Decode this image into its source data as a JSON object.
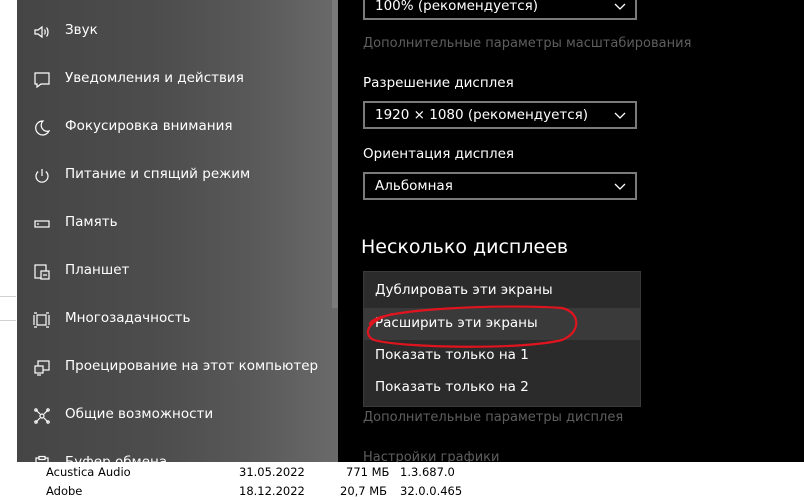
{
  "background_window": {
    "rows": [
      {
        "name": "Acustica Audio",
        "date": "31.05.2022",
        "size": "771 МБ",
        "version": "1.3.687.0"
      },
      {
        "name": "Adobe",
        "date": "18.12.2022",
        "size": "20,7 МБ",
        "version": "32.0.0.465"
      }
    ]
  },
  "sidebar": {
    "items": [
      {
        "label": "Звук",
        "icon": "speaker-icon"
      },
      {
        "label": "Уведомления и действия",
        "icon": "notification-icon"
      },
      {
        "label": "Фокусировка внимания",
        "icon": "moon-icon"
      },
      {
        "label": "Питание и спящий режим",
        "icon": "power-icon"
      },
      {
        "label": "Память",
        "icon": "storage-icon"
      },
      {
        "label": "Планшет",
        "icon": "tablet-icon"
      },
      {
        "label": "Многозадачность",
        "icon": "multitasking-icon"
      },
      {
        "label": "Проецирование на этот компьютер",
        "icon": "projecting-icon"
      },
      {
        "label": "Общие возможности",
        "icon": "shared-experiences-icon"
      },
      {
        "label": "Буфер обмена",
        "icon": "clipboard-icon"
      }
    ]
  },
  "content": {
    "scale_value": "100% (рекомендуется)",
    "advanced_scaling_link": "Дополнительные параметры масштабирования",
    "resolution_label": "Разрешение дисплея",
    "resolution_value": "1920 × 1080 (рекомендуется)",
    "orientation_label": "Ориентация дисплея",
    "orientation_value": "Альбомная",
    "multiple_displays_title": "Несколько дисплеев",
    "multiple_displays_options": [
      "Дублировать эти экраны",
      "Расширить эти экраны",
      "Показать только на 1",
      "Показать только на 2"
    ],
    "advanced_display_link": "Дополнительные параметры дисплея",
    "graphics_settings_link": "Настройки графики"
  },
  "colors": {
    "annotation": "#e0141e"
  }
}
